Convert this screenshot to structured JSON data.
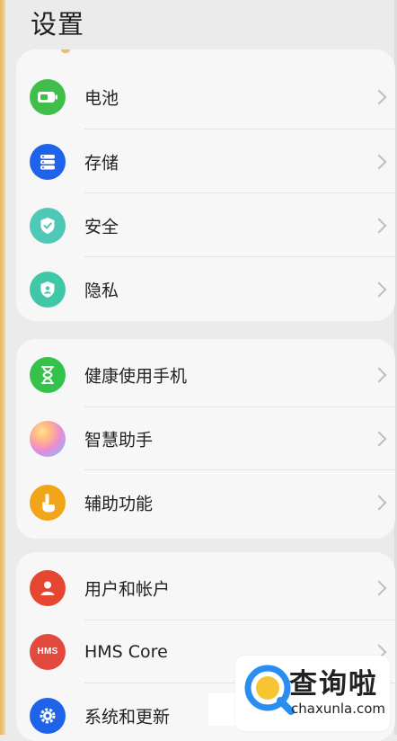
{
  "page": {
    "title": "设置"
  },
  "groups": [
    {
      "items": [
        {
          "label": "电池",
          "icon": "battery-icon",
          "color": "#3fbf4a"
        },
        {
          "label": "存储",
          "icon": "storage-icon",
          "color": "#1e63e9"
        },
        {
          "label": "安全",
          "icon": "shield-check-icon",
          "color": "#4ec9b8"
        },
        {
          "label": "隐私",
          "icon": "privacy-shield-icon",
          "color": "#3fc7a8"
        }
      ]
    },
    {
      "items": [
        {
          "label": "健康使用手机",
          "icon": "hourglass-icon",
          "color": "#35c24a"
        },
        {
          "label": "智慧助手",
          "icon": "assistant-orb-icon",
          "color": "#c9a0e8"
        },
        {
          "label": "辅助功能",
          "icon": "hand-tap-icon",
          "color": "#f3a51a"
        }
      ]
    },
    {
      "items": [
        {
          "label": "用户和帐户",
          "icon": "user-icon",
          "color": "#e5462f"
        },
        {
          "label": "HMS Core",
          "icon": "hms-core-icon",
          "color": "#e24a3e",
          "icon_text": "HMS"
        },
        {
          "label": "系统和更新",
          "icon": "gear-icon",
          "color": "#1e63e9"
        }
      ]
    }
  ],
  "watermark": {
    "name": "查询啦",
    "domain": "chaxunla.com"
  }
}
